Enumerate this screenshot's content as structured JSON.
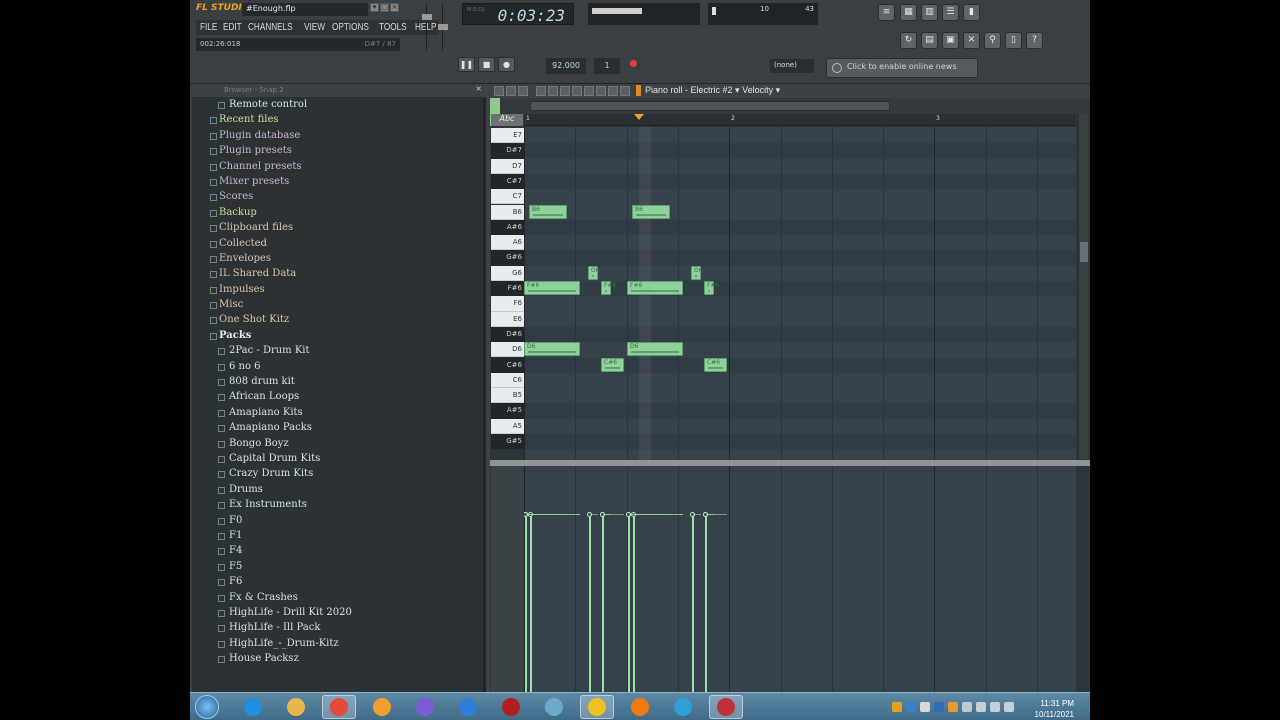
{
  "app": {
    "brand": "FL STUDIO",
    "file_title": "#Enough.flp"
  },
  "menu": [
    "FILE",
    "EDIT",
    "CHANNELS",
    "VIEW",
    "OPTIONS",
    "TOOLS",
    "HELP"
  ],
  "hint_bar": {
    "left": "002:26:018",
    "right": "D#7 / 87"
  },
  "time_display": "0:03:23",
  "monitor": {
    "value1": "10",
    "value2": "43"
  },
  "snap_value": "(none)",
  "news_text": "Click to enable online news",
  "browser": {
    "header": "Browser - Snap 2",
    "items": [
      {
        "label": "Remote control",
        "level": "sub",
        "style": ""
      },
      {
        "label": "Recent files",
        "level": "top",
        "style": "hl"
      },
      {
        "label": "Plugin database",
        "level": "top",
        "style": "purple"
      },
      {
        "label": "Plugin presets",
        "level": "top",
        "style": "purple"
      },
      {
        "label": "Channel presets",
        "level": "top",
        "style": "purple"
      },
      {
        "label": "Mixer presets",
        "level": "top",
        "style": "purple"
      },
      {
        "label": "Scores",
        "level": "top",
        "style": "purple"
      },
      {
        "label": "Backup",
        "level": "top",
        "style": "hl"
      },
      {
        "label": "Clipboard files",
        "level": "top",
        "style": ""
      },
      {
        "label": "Collected",
        "level": "top",
        "style": ""
      },
      {
        "label": "Envelopes",
        "level": "top",
        "style": ""
      },
      {
        "label": "IL Shared Data",
        "level": "top",
        "style": ""
      },
      {
        "label": "Impulses",
        "level": "top",
        "style": ""
      },
      {
        "label": "Misc",
        "level": "top",
        "style": ""
      },
      {
        "label": "One Shot Kitz",
        "level": "top",
        "style": ""
      },
      {
        "label": "Packs",
        "level": "top",
        "style": "open"
      },
      {
        "label": "2Pac - Drum Kit",
        "level": "sub",
        "style": ""
      },
      {
        "label": "6 no 6",
        "level": "sub",
        "style": ""
      },
      {
        "label": "808 drum kit",
        "level": "sub",
        "style": ""
      },
      {
        "label": "African Loops",
        "level": "sub",
        "style": ""
      },
      {
        "label": "Amapiano Kits",
        "level": "sub",
        "style": ""
      },
      {
        "label": "Amapiano Packs",
        "level": "sub",
        "style": ""
      },
      {
        "label": "Bongo Boyz",
        "level": "sub",
        "style": ""
      },
      {
        "label": "Capital Drum Kits",
        "level": "sub",
        "style": ""
      },
      {
        "label": "Crazy Drum Kits",
        "level": "sub",
        "style": ""
      },
      {
        "label": "Drums",
        "level": "sub",
        "style": ""
      },
      {
        "label": "Ex Instruments",
        "level": "sub",
        "style": ""
      },
      {
        "label": "F0",
        "level": "sub",
        "style": ""
      },
      {
        "label": "F1",
        "level": "sub",
        "style": ""
      },
      {
        "label": "F4",
        "level": "sub",
        "style": ""
      },
      {
        "label": "F5",
        "level": "sub",
        "style": ""
      },
      {
        "label": "F6",
        "level": "sub",
        "style": ""
      },
      {
        "label": "Fx & Crashes",
        "level": "sub",
        "style": ""
      },
      {
        "label": "HighLife - Drill Kit 2020",
        "level": "sub",
        "style": ""
      },
      {
        "label": "HighLife - Ill Pack",
        "level": "sub",
        "style": ""
      },
      {
        "label": "HighLife_-_Drum-Kitz",
        "level": "sub",
        "style": ""
      },
      {
        "label": "House Packsz",
        "level": "sub",
        "style": ""
      }
    ]
  },
  "piano_roll": {
    "title": "Piano roll - Electric #2",
    "target": "Velocity",
    "abc": "Abc",
    "ruler": [
      "1",
      "2",
      "3"
    ],
    "keys": [
      "E7",
      "D#7",
      "D7",
      "C#7",
      "C7",
      "B6",
      "A#6",
      "A6",
      "G#6",
      "G6",
      "F#6",
      "F6",
      "E6",
      "D#6",
      "D6",
      "C#6",
      "C6",
      "B5",
      "A#5",
      "A5",
      "G#5"
    ],
    "notes": [
      {
        "pitch": "B6",
        "start": 0.1,
        "len": 0.75,
        "label": "B6"
      },
      {
        "pitch": "B6",
        "start": 2.1,
        "len": 0.75,
        "label": "B6"
      },
      {
        "pitch": "G6",
        "start": 1.25,
        "len": 0.2,
        "label": "G6"
      },
      {
        "pitch": "G6",
        "start": 3.25,
        "len": 0.2,
        "label": "G6"
      },
      {
        "pitch": "F#6",
        "start": 0.0,
        "len": 1.1,
        "label": "F#6"
      },
      {
        "pitch": "F#6",
        "start": 1.5,
        "len": 0.2,
        "label": "F#6"
      },
      {
        "pitch": "F#6",
        "start": 2.0,
        "len": 1.1,
        "label": "F#6"
      },
      {
        "pitch": "F#6",
        "start": 3.5,
        "len": 0.2,
        "label": "F#6"
      },
      {
        "pitch": "D6",
        "start": 0.0,
        "len": 1.1,
        "label": "D6"
      },
      {
        "pitch": "D6",
        "start": 2.0,
        "len": 1.1,
        "label": "D6"
      },
      {
        "pitch": "C#6",
        "start": 1.5,
        "len": 0.45,
        "label": "C#6"
      },
      {
        "pitch": "C#6",
        "start": 3.5,
        "len": 0.45,
        "label": "C#6"
      }
    ]
  },
  "taskbar": {
    "clock_time": "11:31 PM",
    "clock_date": "10/11/2021",
    "apps": [
      "ie-icon",
      "folder-icon",
      "chrome-icon",
      "media-player-icon",
      "visual-studio-icon",
      "search-app-icon",
      "record-app-icon",
      "notes-app-icon",
      "fl-studio-icon",
      "vlc-icon",
      "edge-icon",
      "app-icon"
    ]
  },
  "colors": {
    "note_fill": "#8ed19a",
    "accent_orange": "#f0a020",
    "grid_bg": "#36414a"
  }
}
